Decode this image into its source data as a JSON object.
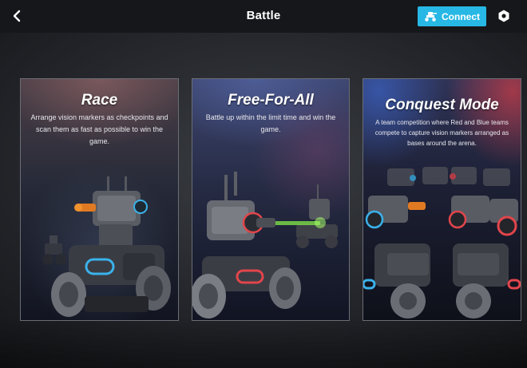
{
  "header": {
    "title": "Battle",
    "connect_label": "Connect",
    "back_icon": "chevron-left-icon",
    "connect_icon": "robot-icon",
    "settings_icon": "hexagon-settings-icon"
  },
  "colors": {
    "accent": "#27b8e5",
    "header_bg": "#16171b",
    "red_team": "#e2454b",
    "blue_team": "#3ab2ea"
  },
  "modes": [
    {
      "title": "Race",
      "description": "Arrange vision markers as checkpoints and scan them as fast as possible to win the game."
    },
    {
      "title": "Free-For-All",
      "description": "Battle up within the limit time and win the game."
    },
    {
      "title": "Conquest Mode",
      "description": "A team competition where Red and Blue teams compete to capture vision markers arranged as bases around the arena."
    }
  ]
}
